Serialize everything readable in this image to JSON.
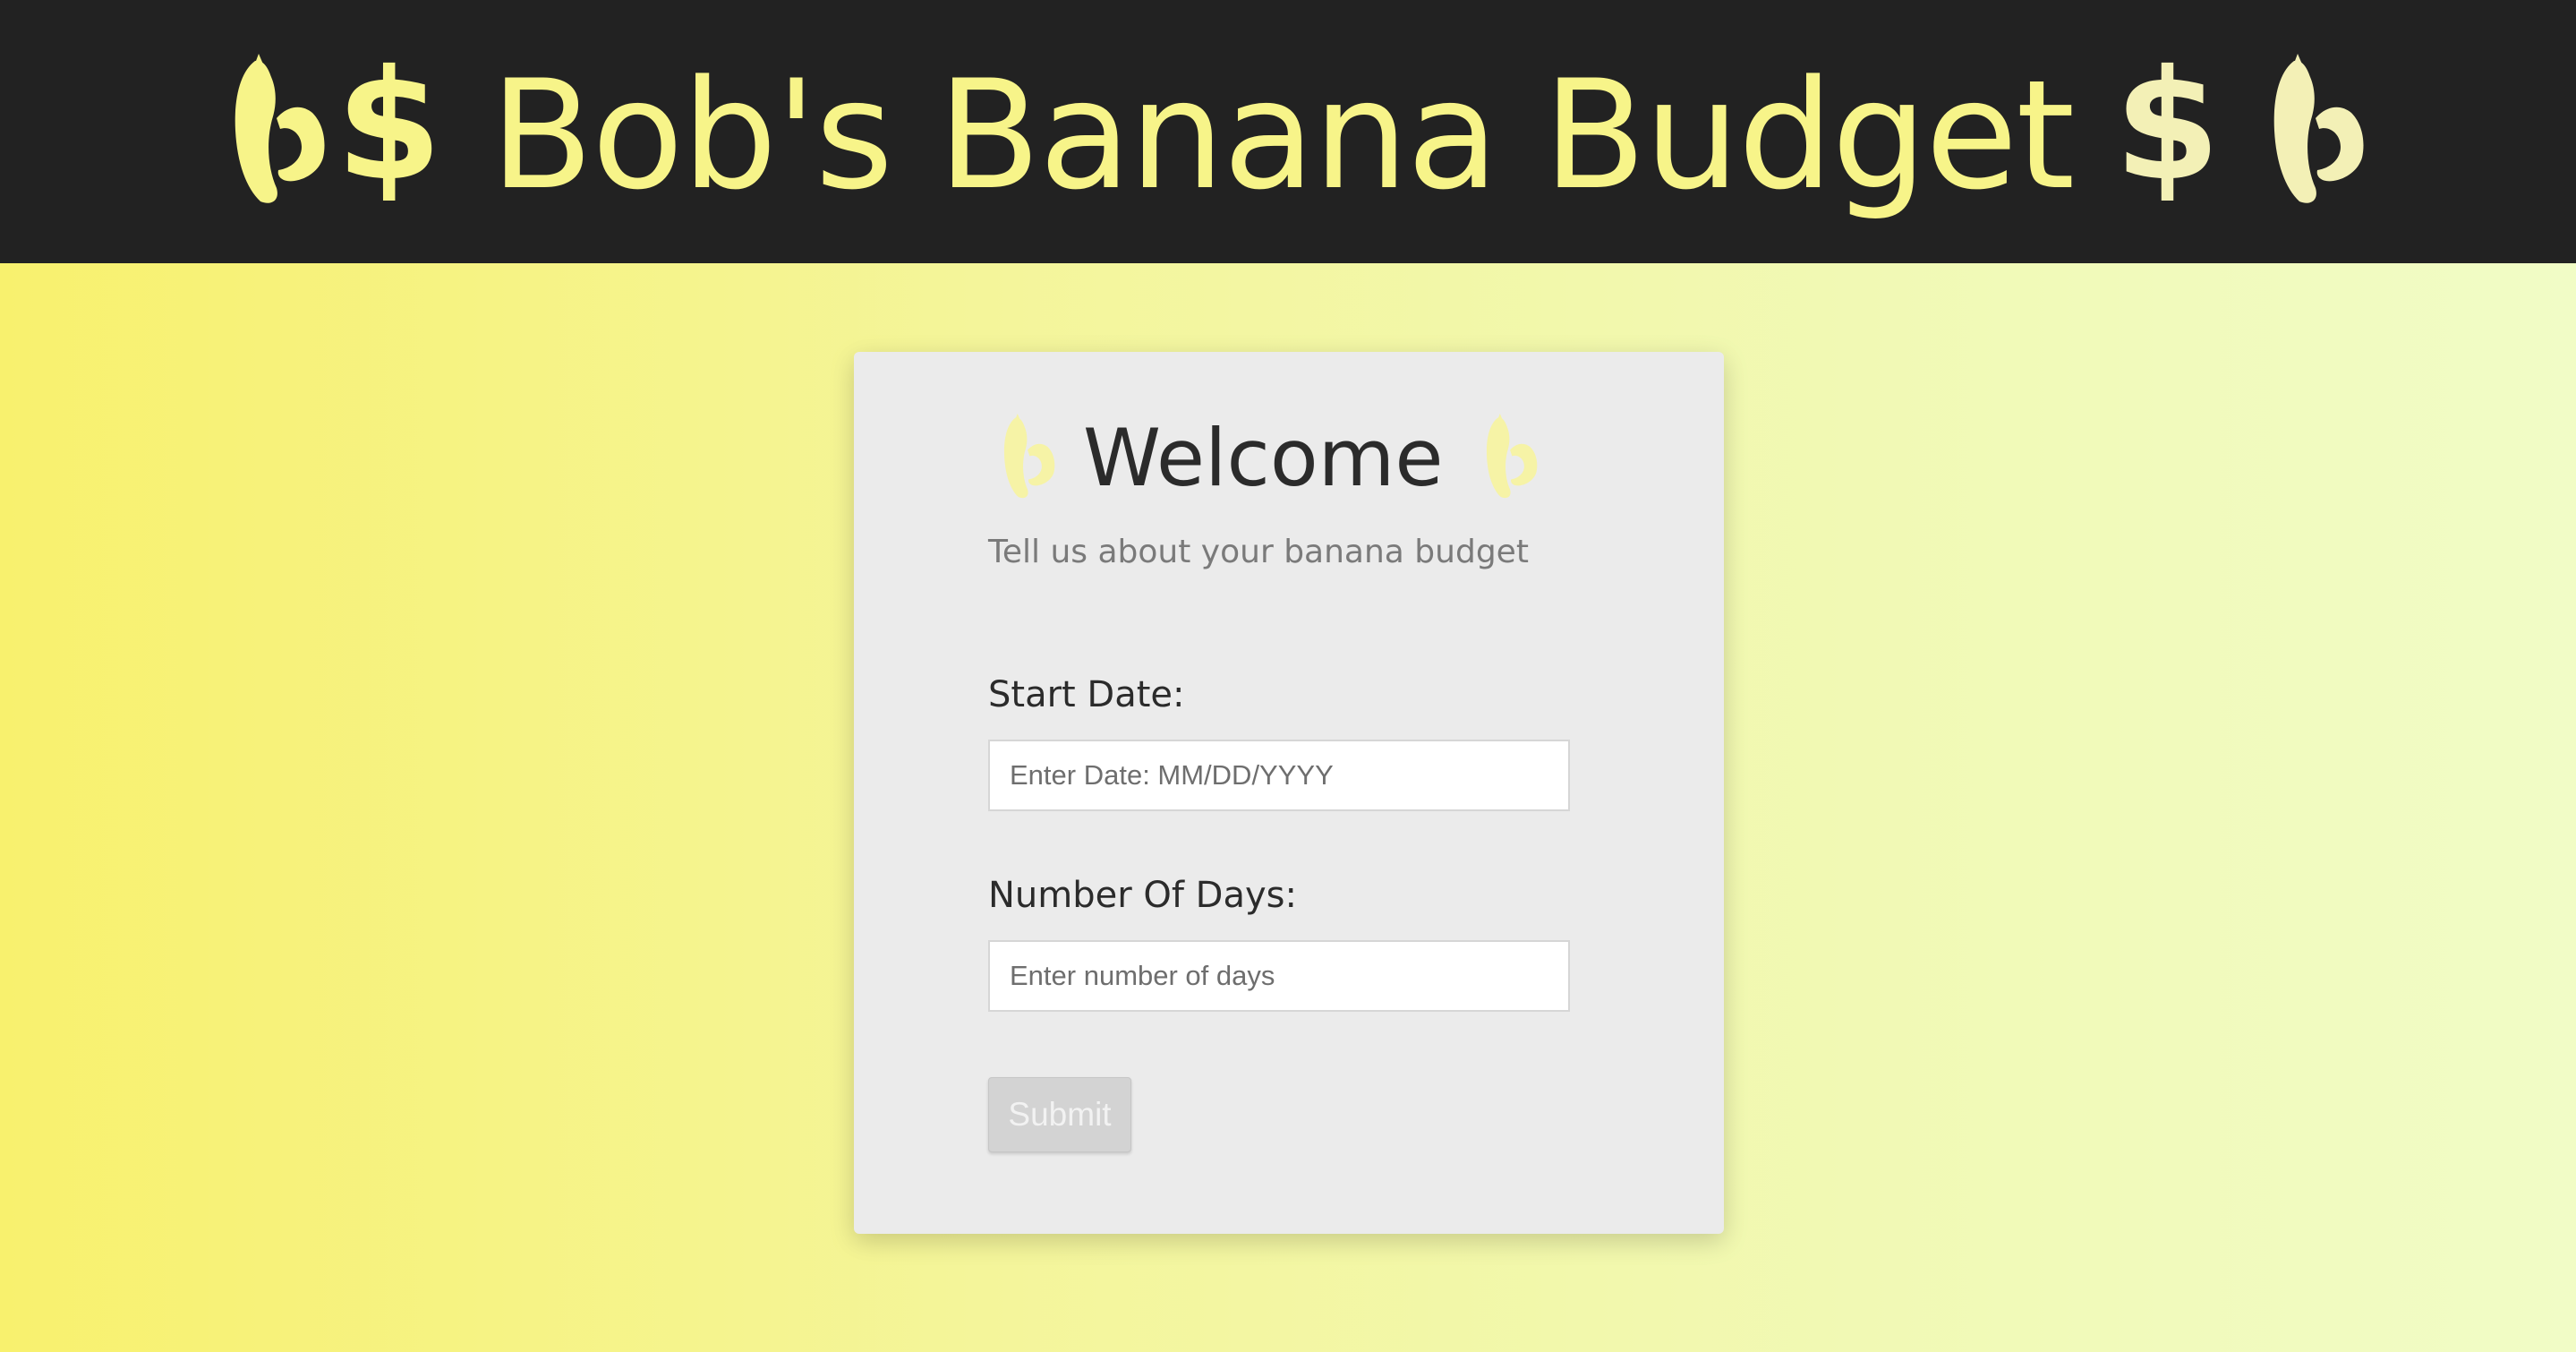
{
  "header": {
    "title": "Bob's Banana Budget",
    "dollar_symbol": "$",
    "title_color": "#f7f489",
    "background": "#222222"
  },
  "card": {
    "heading": "Welcome",
    "subtitle": "Tell us about your banana budget",
    "start_date_label": "Start Date:",
    "start_date_placeholder": "Enter Date: MM/DD/YYYY",
    "days_label": "Number Of Days:",
    "days_placeholder": "Enter number of days",
    "submit_label": "Submit"
  },
  "icons": {
    "banana": "banana-icon",
    "dollar": "dollar-icon"
  }
}
